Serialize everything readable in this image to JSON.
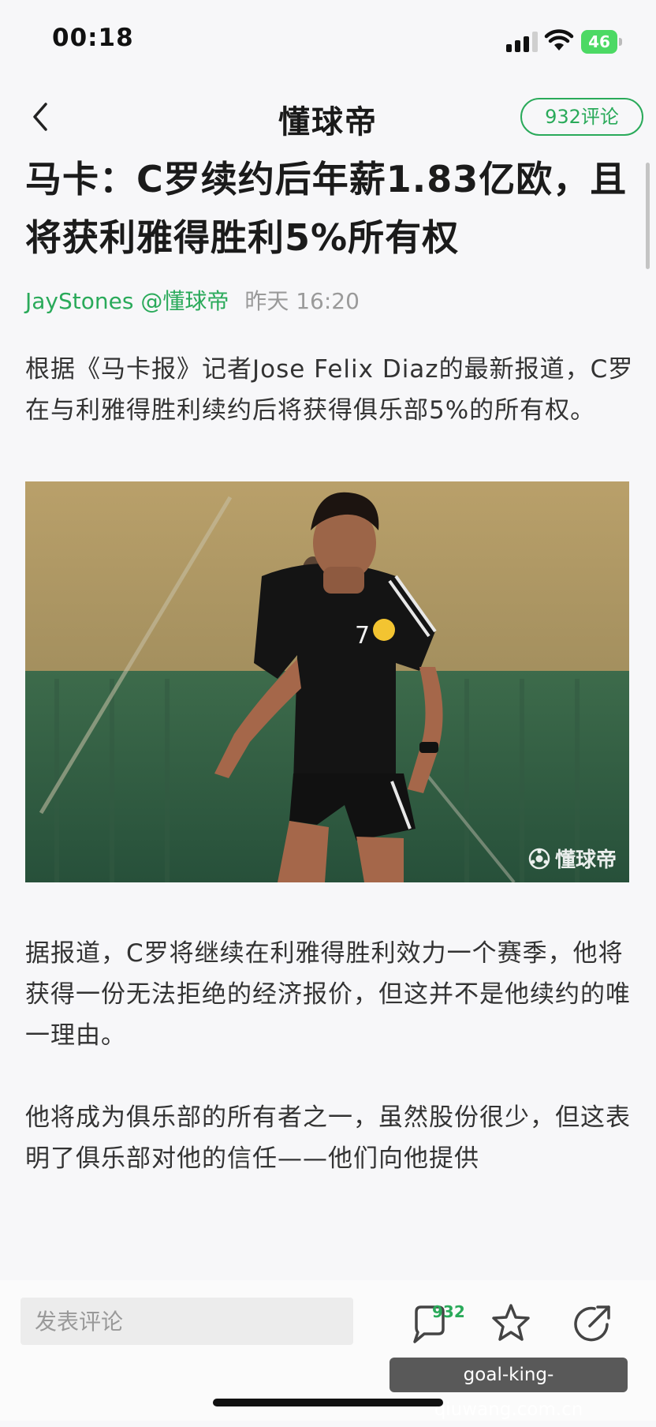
{
  "status_bar": {
    "time": "00:18",
    "battery": "46"
  },
  "header": {
    "title": "懂球帝",
    "comment_button": "932评论"
  },
  "article": {
    "headline": "马卡：C罗续约后年薪1.83亿欧，且将获利雅得胜利5%所有权",
    "author": "JayStones @懂球帝",
    "time": "昨天 16:20",
    "paragraphs": [
      "根据《马卡报》记者Jose Felix Diaz的最新报道，C罗在与利雅得胜利续约后将获得俱乐部5%的所有权。",
      "据报道，C罗将继续在利雅得胜利效力一个赛季，他将获得一份无法拒绝的经济报价，但这并不是他续约的唯一理由。",
      "他将成为俱乐部的所有者之一，虽然股份很少，但这表明了俱乐部对他的信任——他们向他提供"
    ],
    "image": {
      "jersey_number": "7",
      "watermark": "懂球帝"
    }
  },
  "bottom_bar": {
    "comment_placeholder": "发表评论",
    "comment_badge": "932",
    "site_label": "goal-king-qiuwang.com.cn"
  },
  "colors": {
    "accent_green": "#2aaa5a",
    "battery_green": "#4cd964"
  },
  "icons": [
    "back-chevron-icon",
    "signal-icon",
    "wifi-icon",
    "battery-icon",
    "comment-bubble-icon",
    "star-icon",
    "share-icon",
    "watermark-logo-icon"
  ]
}
